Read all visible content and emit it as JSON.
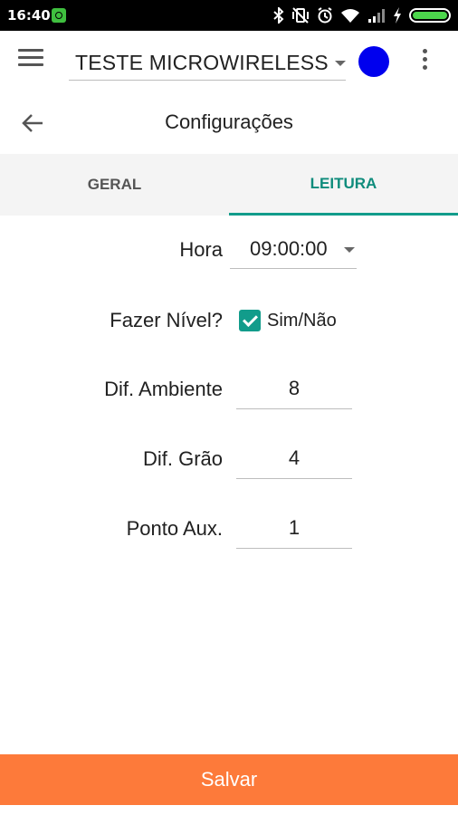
{
  "status_bar": {
    "time": "16:40",
    "icons": [
      "app-notification-icon",
      "bluetooth-icon",
      "vibrate-off-icon",
      "alarm-icon",
      "wifi-icon",
      "signal-icon",
      "charging-icon",
      "battery-icon"
    ],
    "battery_level": 1.0
  },
  "app_bar": {
    "device_name": "TESTE MICROWIRELESS",
    "status_color": "#0000ee"
  },
  "page": {
    "title": "Configurações"
  },
  "tabs": [
    {
      "label": "GERAL",
      "active": false
    },
    {
      "label": "LEITURA",
      "active": true
    }
  ],
  "form": {
    "hora_label": "Hora",
    "hora_value": "09:00:00",
    "nivel_label": "Fazer Nível?",
    "nivel_checkbox_label": "Sim/Não",
    "nivel_checked": true,
    "dif_ambiente_label": "Dif. Ambiente",
    "dif_ambiente_value": "8",
    "dif_grao_label": "Dif. Grão",
    "dif_grao_value": "4",
    "ponto_aux_label": "Ponto Aux.",
    "ponto_aux_value": "1"
  },
  "actions": {
    "save_label": "Salvar"
  },
  "colors": {
    "accent": "#129c8b",
    "save_button": "#fd7a3a"
  }
}
